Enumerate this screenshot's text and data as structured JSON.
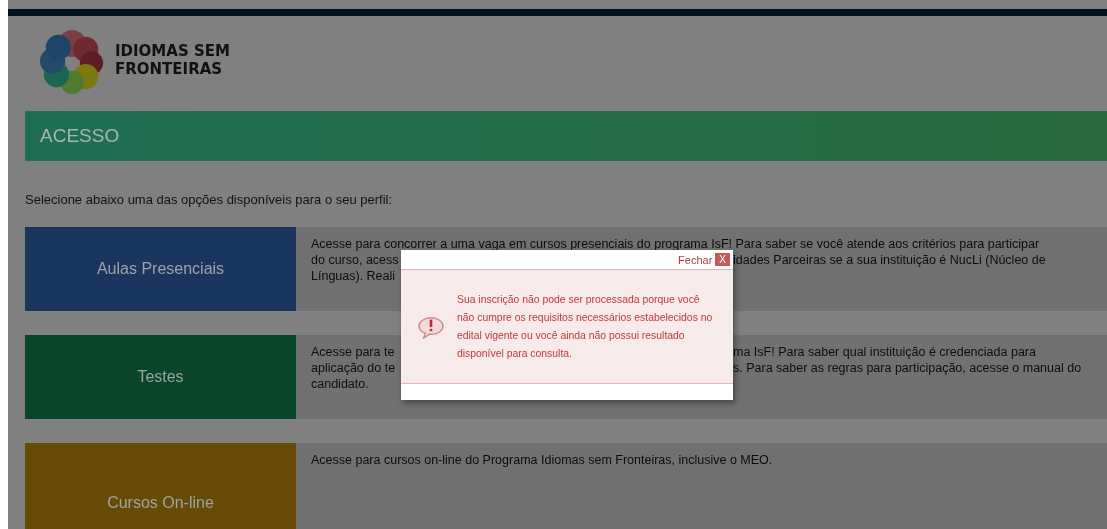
{
  "logo": {
    "lines": [
      "IDIOMAS SEM",
      "FRONTEIRAS"
    ]
  },
  "header": {
    "title": "ACESSO"
  },
  "intro": "Selecione abaixo uma das opções disponíveis para o seu perfil:",
  "options": [
    {
      "label": "Aulas Presenciais",
      "color": "#1a365e",
      "lines": [
        {
          "left": "Acesse para concorrer a uma vaga em cursos presenciais do programa IsF! Para saber se você atende aos critérios para participar"
        },
        {
          "left": "do curso, acess",
          "right": "idades Parceiras se a sua instituição é NucLi (Núcleo de"
        },
        {
          "left": "Línguas). Reali"
        }
      ]
    },
    {
      "label": "Testes",
      "color": "#0a4429",
      "lines": [
        {
          "left": "Acesse para te",
          "right": "ma IsF! Para saber qual instituição é credenciada para"
        },
        {
          "left": "aplicação do te",
          "right": "s. Para saber as regras para participação, acesse o manual do"
        },
        {
          "left": "candidato."
        }
      ]
    },
    {
      "label": "Cursos On-line",
      "color": "#654b05",
      "lines": [
        {
          "left": "Acesse para cursos on-line do Programa Idiomas sem Fronteiras, inclusive o MEO."
        }
      ]
    }
  ],
  "dialog": {
    "close_label": "Fechar",
    "close_button": "X",
    "message": "Sua inscrição não pode ser processada porque você não cumpre os requisitos necessários estabelecidos no edital vigente ou você ainda não possui resultado disponível para consulta."
  }
}
